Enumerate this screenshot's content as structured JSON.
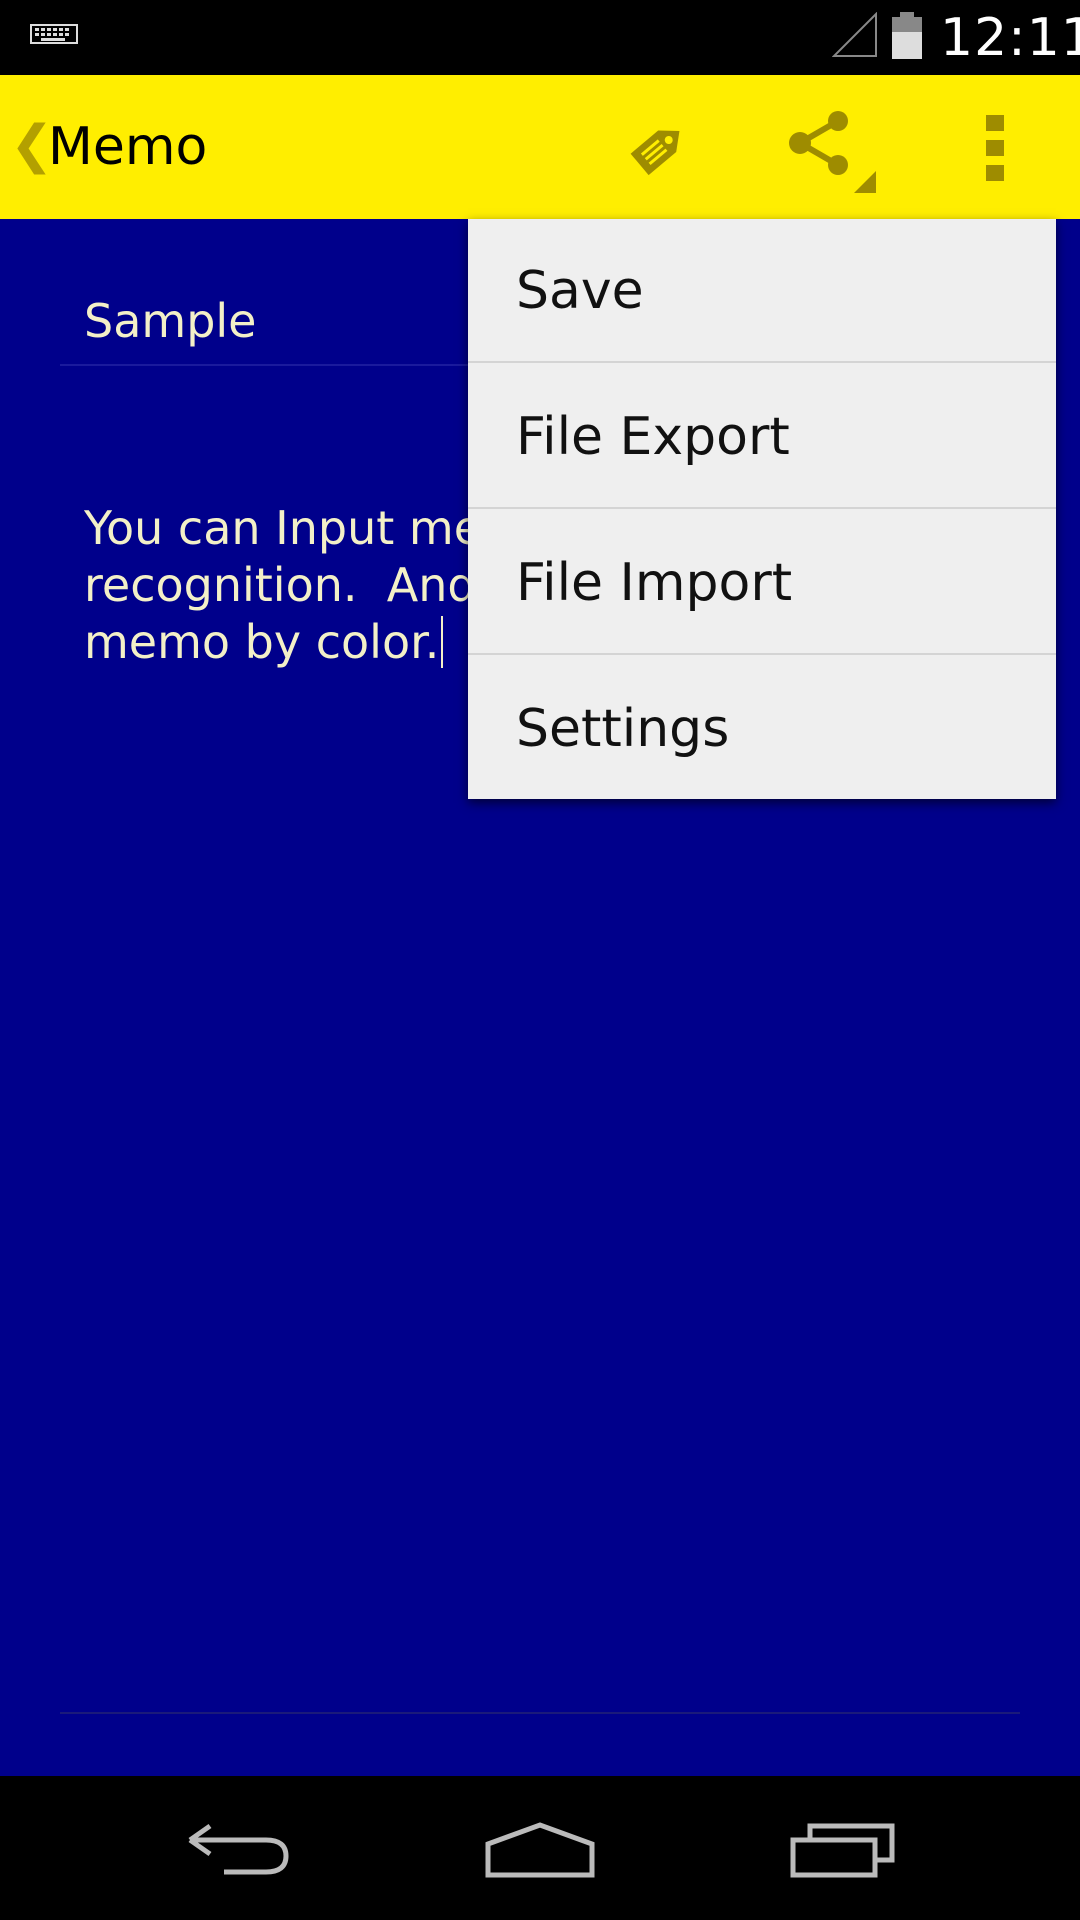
{
  "status_bar": {
    "time": "12:11",
    "icons": [
      "keyboard-icon",
      "signal-icon",
      "battery-icon"
    ]
  },
  "action_bar": {
    "title": "Memo",
    "background_color": "#FFEE00",
    "icons": [
      "tag-icon",
      "share-icon",
      "overflow-menu-icon"
    ]
  },
  "memo": {
    "title": "Sample",
    "body": "You can Input mer\nrecognition.  And y\nmemo by color.",
    "background_color": "#00008B",
    "text_color": "#F3F0C8"
  },
  "menu": {
    "items": [
      {
        "label": "Save"
      },
      {
        "label": "File Export"
      },
      {
        "label": "File Import"
      },
      {
        "label": "Settings"
      }
    ]
  },
  "nav_bar": {
    "icons": [
      "back-icon",
      "home-icon",
      "recents-icon"
    ]
  }
}
